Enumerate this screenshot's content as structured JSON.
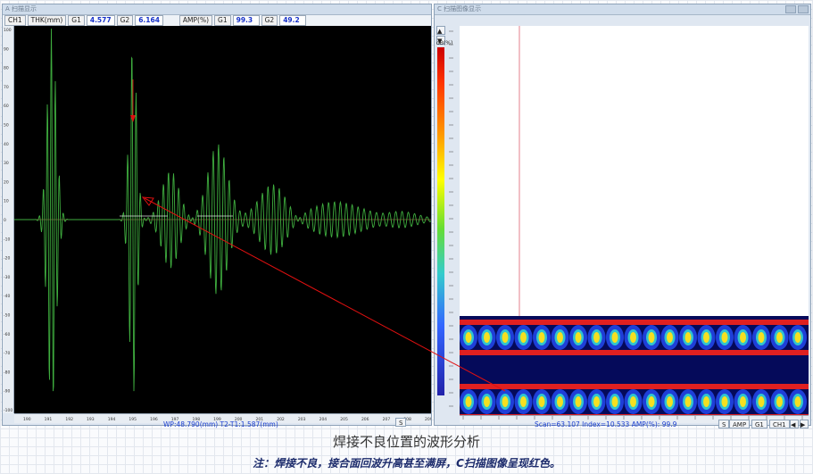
{
  "left_panel": {
    "title": "A 扫描显示",
    "channel": "CH1",
    "thk_label": "THK(mm)",
    "g1_label": "G1",
    "g1_value": "4.577",
    "g2_label": "G2",
    "g2_value": "6.164",
    "amp_label": "AMP(%)",
    "amp_g1_label": "G1",
    "amp_g1_value": "99.3",
    "amp_g2_label": "G2",
    "amp_g2_value": "49.2",
    "status": "WP:48.790(mm)  T2-T1:1.587(mm)",
    "s_button": "S"
  },
  "right_panel": {
    "title": "C 扫描图像显示",
    "status": "Scan=63.107 Index=10.533  AMP(%): 99.9",
    "buttons": [
      "S",
      "AMP",
      "G1",
      "CH1"
    ],
    "colorbar_label": "dB(%)"
  },
  "captions": {
    "main": "焊接不良位置的波形分析",
    "note": "注：焊接不良，接合面回波升高甚至满屏，C扫描图像呈现红色。"
  },
  "colors": {
    "wave": "#3fae3f",
    "arrow": "#e01010",
    "plot_bg": "#000000",
    "value_text": "#1530c8"
  },
  "chart_data": {
    "type": "line",
    "title": "",
    "xlabel": "",
    "ylabel": "",
    "y_ticks": [
      "100",
      "90",
      "80",
      "70",
      "60",
      "50",
      "40",
      "30",
      "20",
      "10",
      "0",
      "-10",
      "-20",
      "-30",
      "-40",
      "-50",
      "-60",
      "-70",
      "-80",
      "-90",
      "-100"
    ],
    "x_ticks": [
      "190",
      "191",
      "192",
      "193",
      "194",
      "195",
      "196",
      "197",
      "198",
      "199",
      "200",
      "201",
      "202",
      "203",
      "204",
      "205",
      "206",
      "207",
      "208",
      "209"
    ],
    "ylim": [
      -100,
      100
    ]
  }
}
